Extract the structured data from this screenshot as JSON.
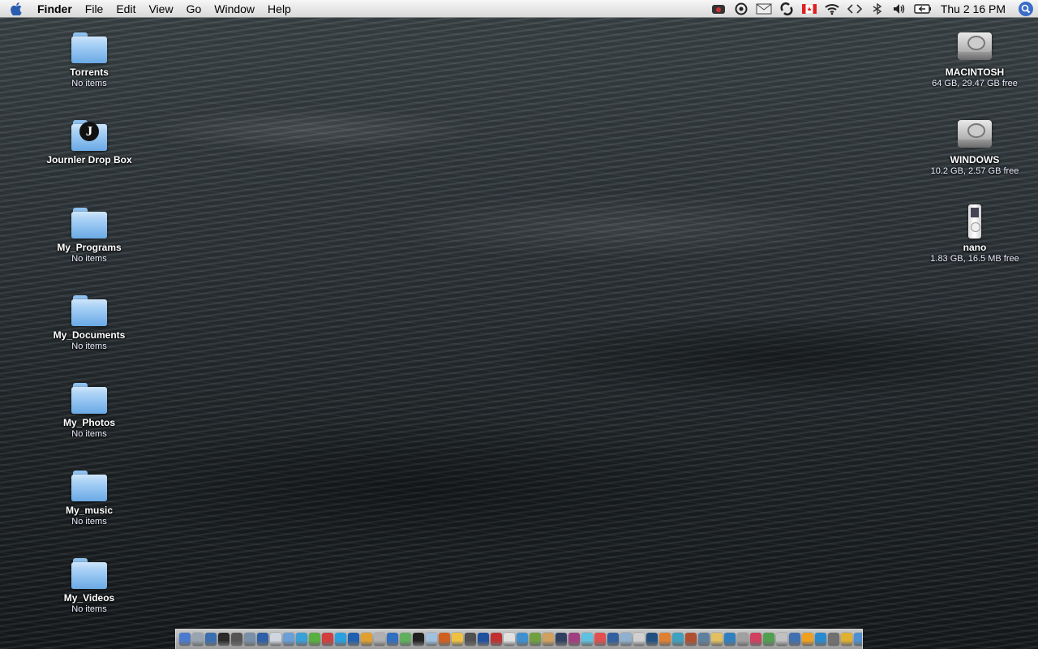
{
  "menubar": {
    "apple_icon": "apple-logo-icon",
    "app_name": "Finder",
    "menus": [
      "File",
      "Edit",
      "View",
      "Go",
      "Window",
      "Help"
    ],
    "status_icons": [
      "camera-icon",
      "target-icon",
      "mail-icon",
      "sync-icon",
      "canada-flag-icon",
      "wifi-icon",
      "code-brackets-icon",
      "bluetooth-icon",
      "volume-icon",
      "battery-icon"
    ],
    "clock": "Thu 2 16 PM",
    "spotlight_icon": "spotlight-icon"
  },
  "desktop": {
    "left_icons": [
      {
        "name": "Torrents",
        "sub": "No items",
        "kind": "folder"
      },
      {
        "name": "Journler Drop Box",
        "sub": "",
        "kind": "journler-folder"
      },
      {
        "name": "My_Programs",
        "sub": "No items",
        "kind": "folder"
      },
      {
        "name": "My_Documents",
        "sub": "No items",
        "kind": "folder"
      },
      {
        "name": "My_Photos",
        "sub": "No items",
        "kind": "folder"
      },
      {
        "name": "My_music",
        "sub": "No items",
        "kind": "folder"
      },
      {
        "name": "My_Videos",
        "sub": "No items",
        "kind": "folder"
      }
    ],
    "right_icons": [
      {
        "name": "MACINTOSH",
        "sub": "64 GB, 29.47 GB free",
        "kind": "hard-disk"
      },
      {
        "name": "WINDOWS",
        "sub": "10.2 GB, 2.57 GB free",
        "kind": "hard-disk"
      },
      {
        "name": "nano",
        "sub": "1.83 GB, 16.5 MB free",
        "kind": "ipod"
      }
    ]
  },
  "dock": {
    "item_colors": [
      "#4a7bd0",
      "#9aa4b0",
      "#3a6fb0",
      "#2a2a2a",
      "#555",
      "#7a8fa8",
      "#2f5fa8",
      "#d0d6df",
      "#6a9fd8",
      "#3aa0d8",
      "#58b040",
      "#d04040",
      "#2aa0e0",
      "#2060b0",
      "#e0a030",
      "#b0b0b0",
      "#3070c0",
      "#60b060",
      "#202020",
      "#a0c0e0",
      "#d06020",
      "#f0c040",
      "#505050",
      "#2050a0",
      "#c03030",
      "#e0e0e0",
      "#4090d0",
      "#70a040",
      "#d0a060",
      "#304060",
      "#a04080",
      "#60c0e0",
      "#e05050",
      "#3060a0",
      "#90b0d0",
      "#d0d0d0",
      "#205080",
      "#e08030",
      "#40a0c0",
      "#b05030",
      "#6080a0",
      "#e0c060",
      "#3080c0",
      "#a0a0a0",
      "#d04060",
      "#50a050",
      "#c0c0c0",
      "#4070b0",
      "#f0a020",
      "#2a8ad0",
      "#707070",
      "#e0b030",
      "#5090d0",
      "#c06040",
      "#f0d050"
    ],
    "trash_icon": "trash-icon"
  }
}
